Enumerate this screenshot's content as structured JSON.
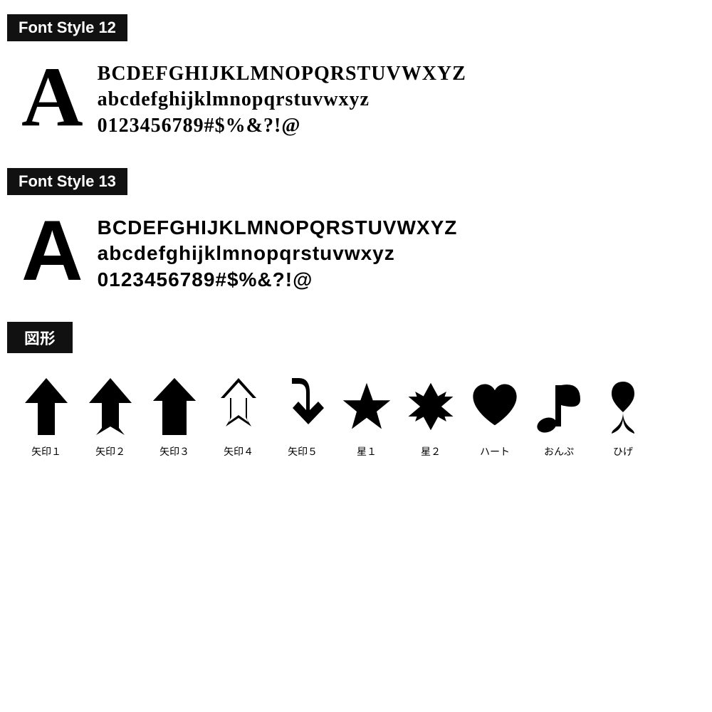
{
  "fontStyle12": {
    "badge": "Font Style 12",
    "bigLetter": "A",
    "lines": [
      "BCDEFGHIJKLMNOPQRSTUVWXYZ",
      "abcdefghijklmnopqrstuvwxyz",
      "0123456789#$%&?!@"
    ]
  },
  "fontStyle13": {
    "badge": "Font Style 13",
    "bigLetter": "A",
    "lines": [
      "BCDEFGHIJKLMNOPQRSTUVWXYZ",
      "abcdefghijklmnopqrstuvwxyz",
      "0123456789#$%&?!@"
    ]
  },
  "shapes": {
    "badge": "図形",
    "items": [
      {
        "label": "矢印１",
        "type": "arrow1"
      },
      {
        "label": "矢印２",
        "type": "arrow2"
      },
      {
        "label": "矢印３",
        "type": "arrow3"
      },
      {
        "label": "矢印４",
        "type": "arrow4"
      },
      {
        "label": "矢印５",
        "type": "arrow5"
      },
      {
        "label": "星１",
        "type": "star1"
      },
      {
        "label": "星２",
        "type": "star2"
      },
      {
        "label": "ハート",
        "type": "heart"
      },
      {
        "label": "おんぷ",
        "type": "note"
      },
      {
        "label": "ひげ",
        "type": "curl"
      }
    ]
  }
}
